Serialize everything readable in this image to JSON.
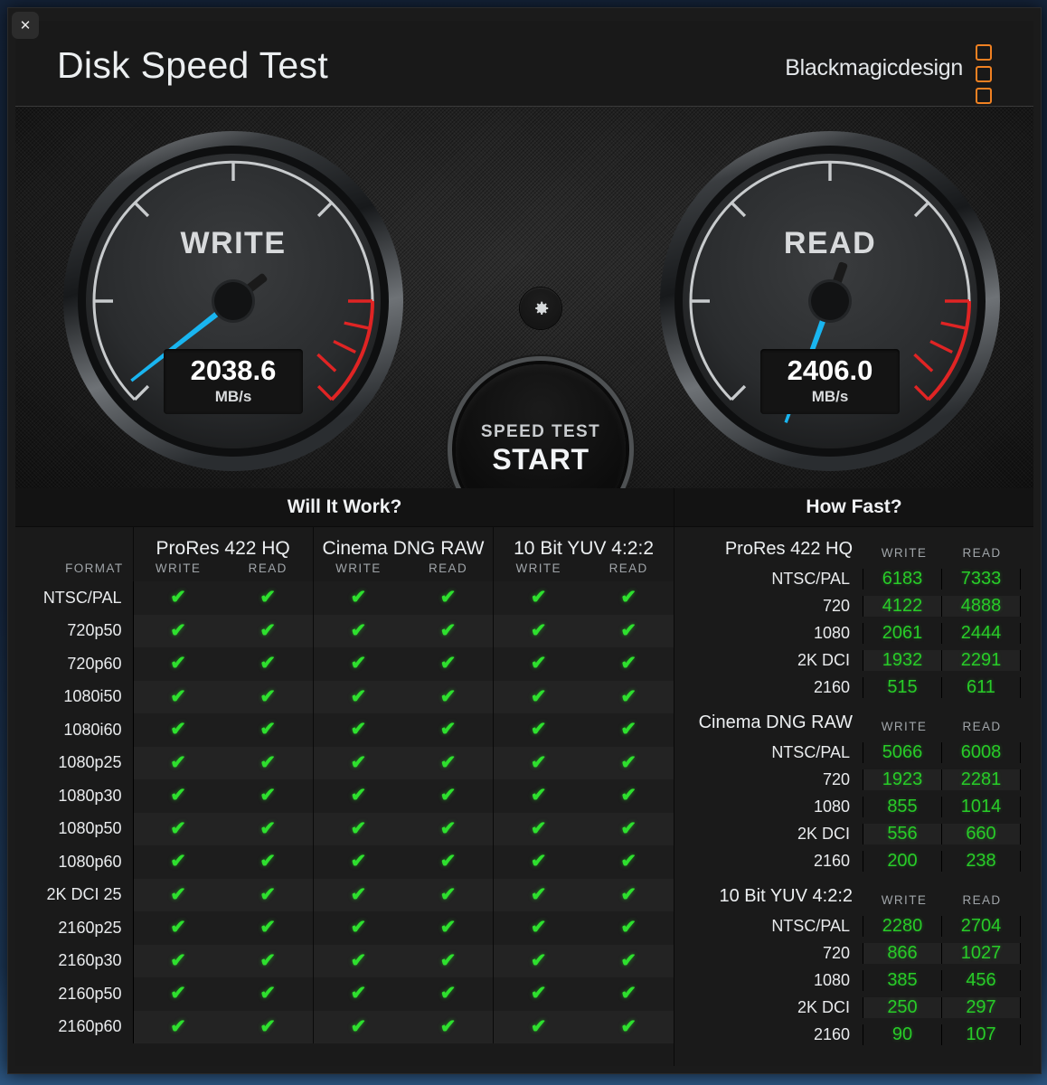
{
  "window": {
    "close_label": "✕",
    "title": "Disk Speed Test",
    "brand": "Blackmagicdesign"
  },
  "gauges": {
    "write": {
      "label": "WRITE",
      "value": "2038.6",
      "unit": "MB/s",
      "needle_angle_deg": -128,
      "needle_color": "#19b5f0"
    },
    "read": {
      "label": "READ",
      "value": "2406.0",
      "unit": "MB/s",
      "needle_angle_deg": -160,
      "needle_color": "#19b5f0"
    }
  },
  "controls": {
    "gear_icon": "gear-icon",
    "start_line1": "SPEED TEST",
    "start_line2": "START"
  },
  "will_it_work": {
    "title": "Will It Work?",
    "format_header": "FORMAT",
    "groups": [
      {
        "name": "ProRes 422 HQ",
        "write": "WRITE",
        "read": "READ"
      },
      {
        "name": "Cinema DNG RAW",
        "write": "WRITE",
        "read": "READ"
      },
      {
        "name": "10 Bit YUV 4:2:2",
        "write": "WRITE",
        "read": "READ"
      }
    ],
    "check_glyph": "✔",
    "check_color": "#2ee02e",
    "rows": [
      {
        "format": "NTSC/PAL",
        "cells": [
          true,
          true,
          true,
          true,
          true,
          true
        ]
      },
      {
        "format": "720p50",
        "cells": [
          true,
          true,
          true,
          true,
          true,
          true
        ]
      },
      {
        "format": "720p60",
        "cells": [
          true,
          true,
          true,
          true,
          true,
          true
        ]
      },
      {
        "format": "1080i50",
        "cells": [
          true,
          true,
          true,
          true,
          true,
          true
        ]
      },
      {
        "format": "1080i60",
        "cells": [
          true,
          true,
          true,
          true,
          true,
          true
        ]
      },
      {
        "format": "1080p25",
        "cells": [
          true,
          true,
          true,
          true,
          true,
          true
        ]
      },
      {
        "format": "1080p30",
        "cells": [
          true,
          true,
          true,
          true,
          true,
          true
        ]
      },
      {
        "format": "1080p50",
        "cells": [
          true,
          true,
          true,
          true,
          true,
          true
        ]
      },
      {
        "format": "1080p60",
        "cells": [
          true,
          true,
          true,
          true,
          true,
          true
        ]
      },
      {
        "format": "2K DCI 25",
        "cells": [
          true,
          true,
          true,
          true,
          true,
          true
        ]
      },
      {
        "format": "2160p25",
        "cells": [
          true,
          true,
          true,
          true,
          true,
          true
        ]
      },
      {
        "format": "2160p30",
        "cells": [
          true,
          true,
          true,
          true,
          true,
          true
        ]
      },
      {
        "format": "2160p50",
        "cells": [
          true,
          true,
          true,
          true,
          true,
          true
        ]
      },
      {
        "format": "2160p60",
        "cells": [
          true,
          true,
          true,
          true,
          true,
          true
        ]
      }
    ]
  },
  "how_fast": {
    "title": "How Fast?",
    "write_header": "WRITE",
    "read_header": "READ",
    "blocks": [
      {
        "name": "ProRes 422 HQ",
        "rows": [
          {
            "label": "NTSC/PAL",
            "write": "6183",
            "read": "7333"
          },
          {
            "label": "720",
            "write": "4122",
            "read": "4888"
          },
          {
            "label": "1080",
            "write": "2061",
            "read": "2444"
          },
          {
            "label": "2K DCI",
            "write": "1932",
            "read": "2291"
          },
          {
            "label": "2160",
            "write": "515",
            "read": "611"
          }
        ]
      },
      {
        "name": "Cinema DNG RAW",
        "rows": [
          {
            "label": "NTSC/PAL",
            "write": "5066",
            "read": "6008"
          },
          {
            "label": "720",
            "write": "1923",
            "read": "2281"
          },
          {
            "label": "1080",
            "write": "855",
            "read": "1014"
          },
          {
            "label": "2K DCI",
            "write": "556",
            "read": "660"
          },
          {
            "label": "2160",
            "write": "200",
            "read": "238"
          }
        ]
      },
      {
        "name": "10 Bit YUV 4:2:2",
        "rows": [
          {
            "label": "NTSC/PAL",
            "write": "2280",
            "read": "2704"
          },
          {
            "label": "720",
            "write": "866",
            "read": "1027"
          },
          {
            "label": "1080",
            "write": "385",
            "read": "456"
          },
          {
            "label": "2K DCI",
            "write": "250",
            "read": "297"
          },
          {
            "label": "2160",
            "write": "90",
            "read": "107"
          }
        ]
      }
    ]
  },
  "colors": {
    "accent_orange": "#f08122",
    "needle_blue": "#19b5f0",
    "value_green": "#28cc28",
    "redzone": "#e02020"
  }
}
